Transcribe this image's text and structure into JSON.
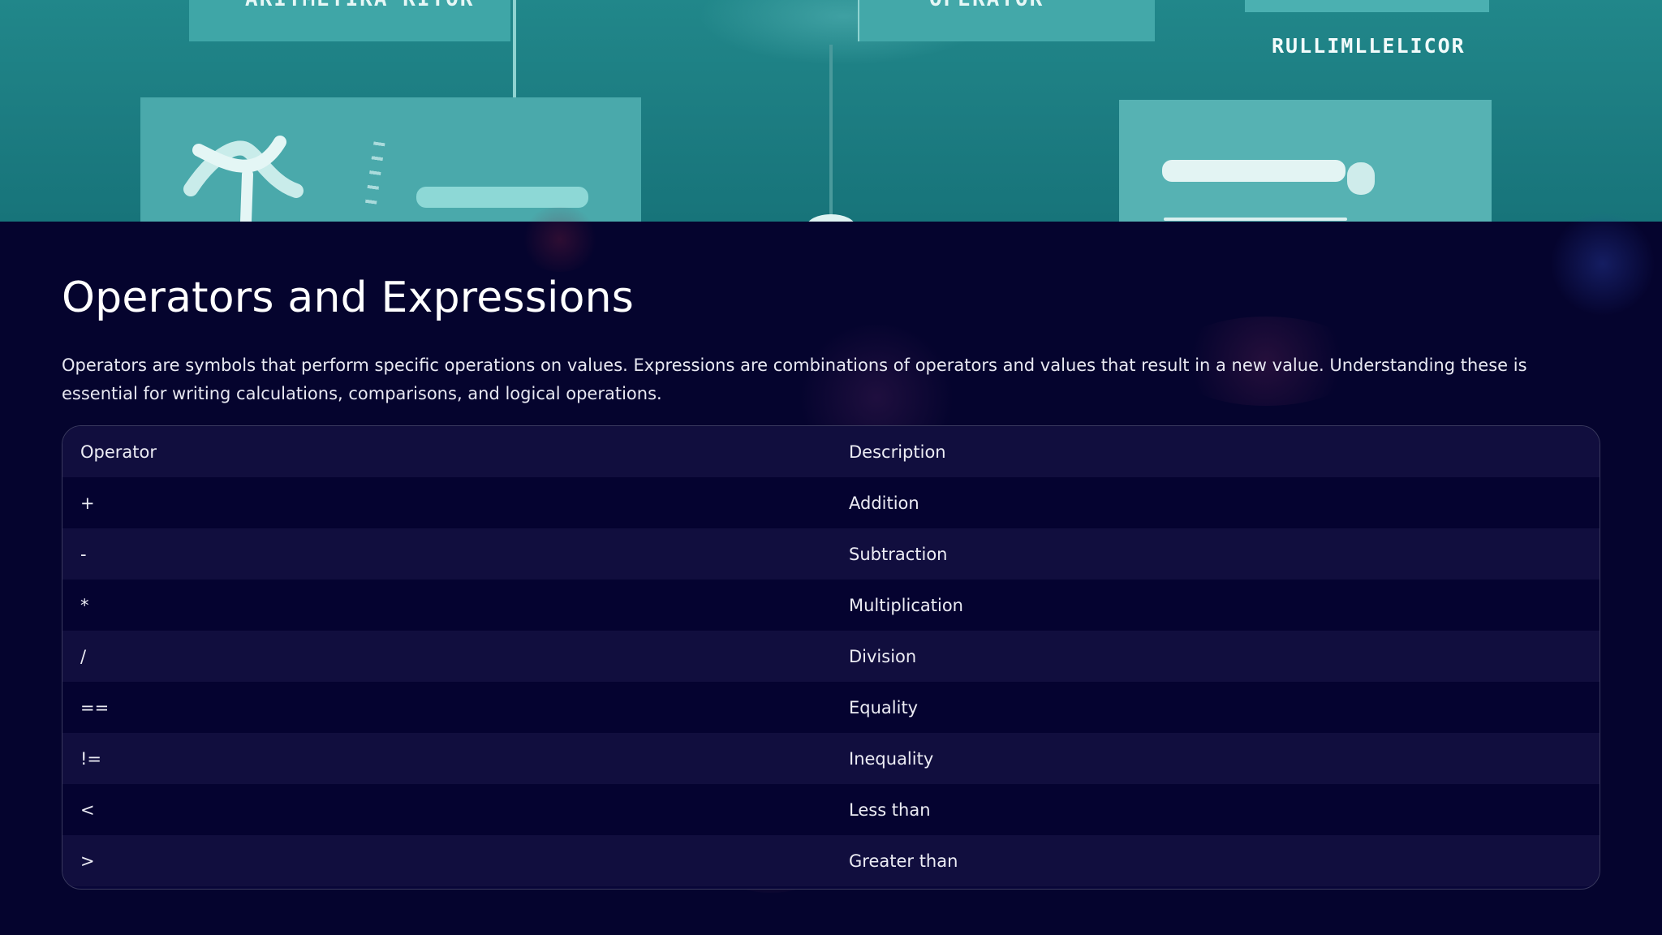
{
  "hero": {
    "label_left": "ARITMETIKA RITOR",
    "label_center": "OPERATOR",
    "label_right": "RULLIMLLELICOR"
  },
  "page": {
    "title": "Operators and Expressions",
    "intro": "Operators are symbols that perform specific operations on values. Expressions are combinations of operators and values that result in a new value. Understanding these is essential for writing calculations, comparisons, and logical operations."
  },
  "table": {
    "headers": [
      "Operator",
      "Description"
    ],
    "rows": [
      [
        "+",
        "Addition"
      ],
      [
        "-",
        "Subtraction"
      ],
      [
        "*",
        "Multiplication"
      ],
      [
        "/",
        "Division"
      ],
      [
        "==",
        "Equality"
      ],
      [
        "!=",
        "Inequality"
      ],
      [
        "<",
        "Less than"
      ],
      [
        ">",
        "Greater than"
      ]
    ]
  },
  "colors": {
    "background": "#05042e",
    "hero_teal": "#1c7c81",
    "row_alt": "#110e3e",
    "row_base": "#050330",
    "border": "#3a3a5e"
  }
}
